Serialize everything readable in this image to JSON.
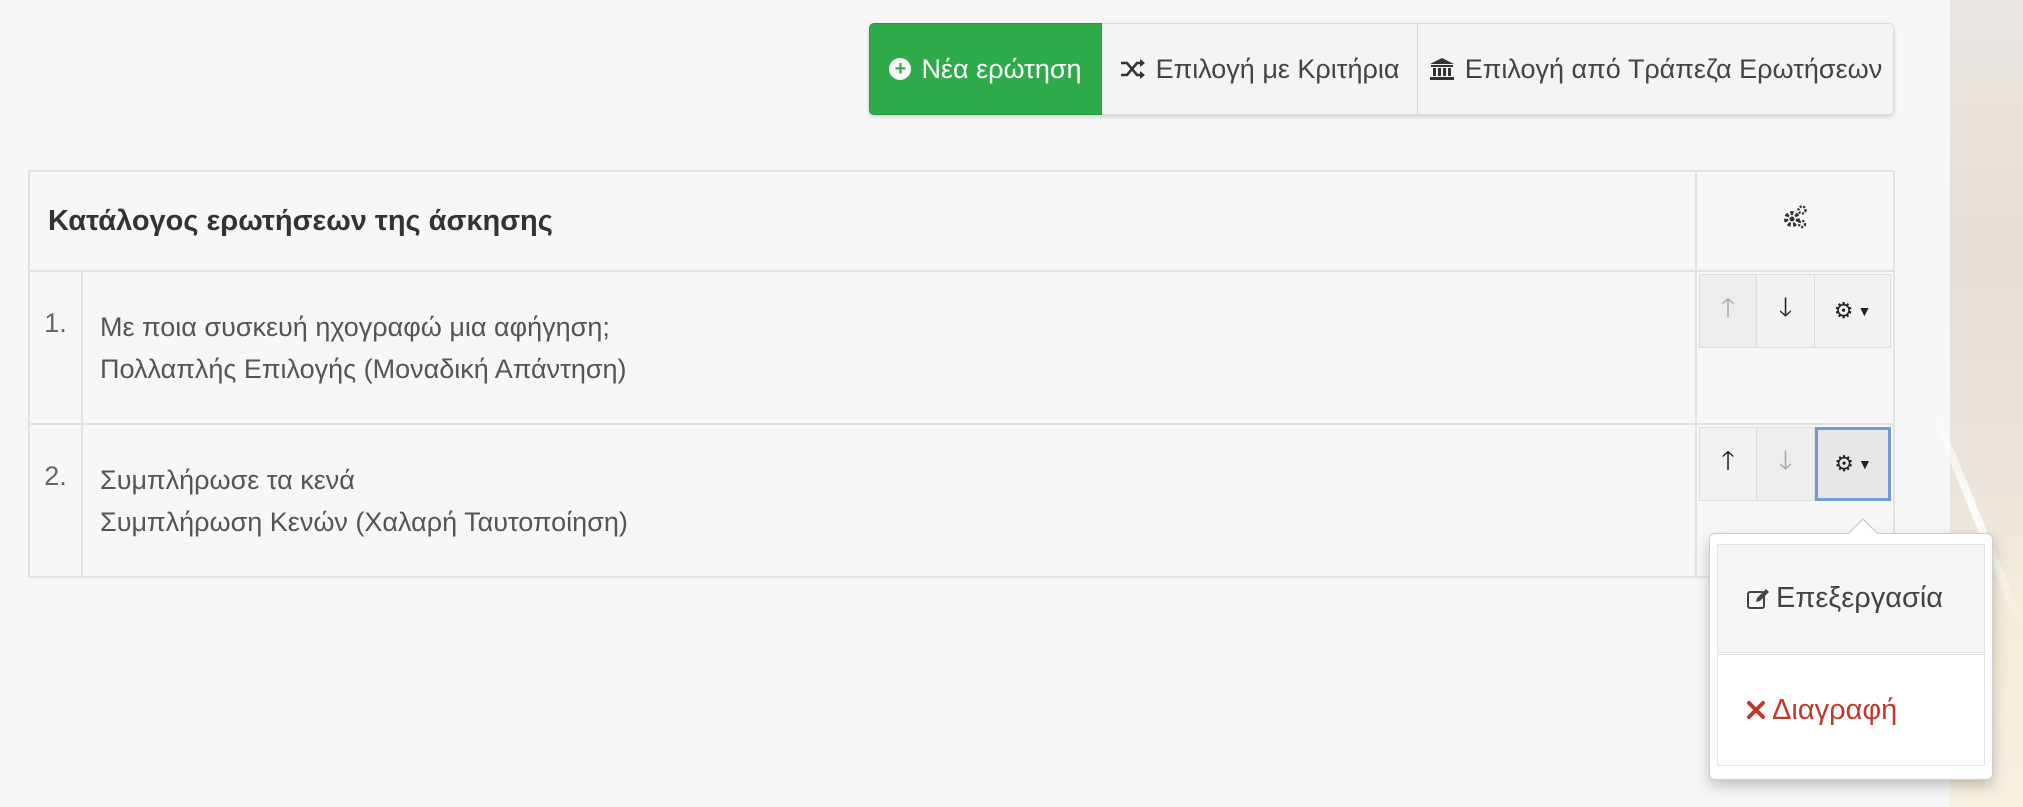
{
  "toolbar": {
    "new_question": "Νέα ερώτηση",
    "select_by_criteria": "Επιλογή με Κριτήρια",
    "select_from_bank": "Επιλογή από Τράπεζα Ερωτήσεων"
  },
  "table": {
    "header": "Κατάλογος ερωτήσεων της άσκησης",
    "rows": [
      {
        "num": "1.",
        "title": "Με ποια συσκευή ηχογραφώ μια αφήγηση;",
        "type": "Πολλαπλής Επιλογής (Μοναδική Απάντηση)"
      },
      {
        "num": "2.",
        "title": "Συμπλήρωσε τα κενά",
        "type": "Συμπλήρωση Κενών (Χαλαρή Ταυτοποίηση)"
      }
    ]
  },
  "dropdown": {
    "edit": "Επεξεργασία",
    "delete": "Διαγραφή"
  },
  "colors": {
    "success": "#2eaa4a",
    "danger": "#c0392b",
    "focus": "#6f9bd6"
  }
}
